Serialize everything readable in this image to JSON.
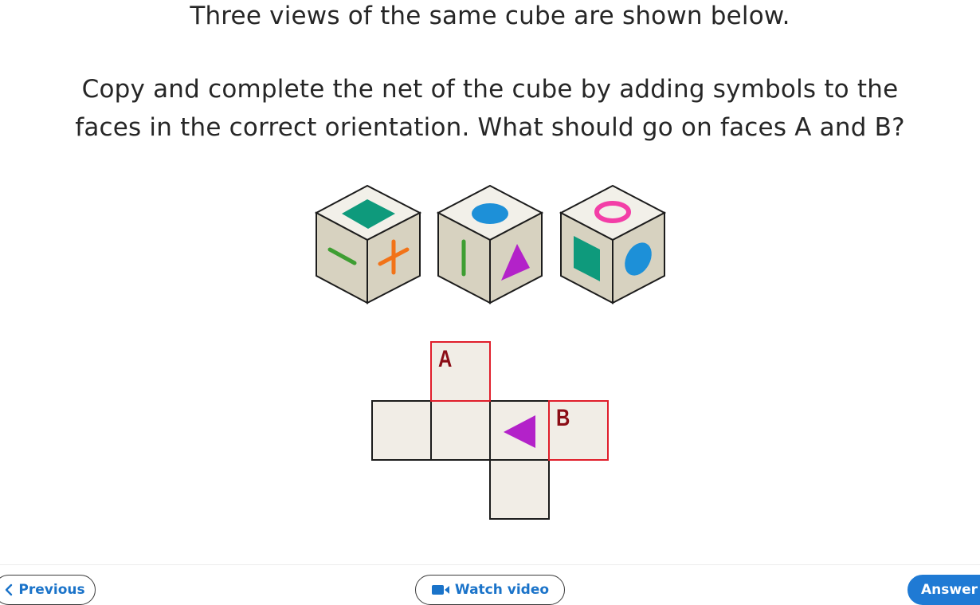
{
  "question": {
    "line1": "Three views of the same cube are shown below.",
    "line2a": "Copy and complete the net of the cube by adding symbols to the",
    "line2b": "faces in the correct orientation. What should go on faces A and B?"
  },
  "cubes": [
    {
      "top": "diamond",
      "left": "dash",
      "right": "plus"
    },
    {
      "top": "oval",
      "left": "bar",
      "right": "triangle"
    },
    {
      "top": "ring",
      "left": "square",
      "right": "ellipse"
    }
  ],
  "net": {
    "face_a_label": "A",
    "face_b_label": "B",
    "known_symbol": "triangle-left"
  },
  "footer": {
    "previous_label": "Previous",
    "video_label": "Watch video",
    "answer_label": "Answer"
  },
  "colors": {
    "teal": "#0e9a7c",
    "blue": "#1d90d8",
    "pink": "#f33ea7",
    "purple": "#b322c9",
    "orange": "#f27318",
    "green": "#3e9e32",
    "accent": "#1f7ad4",
    "highlight": "#e01e2b"
  }
}
